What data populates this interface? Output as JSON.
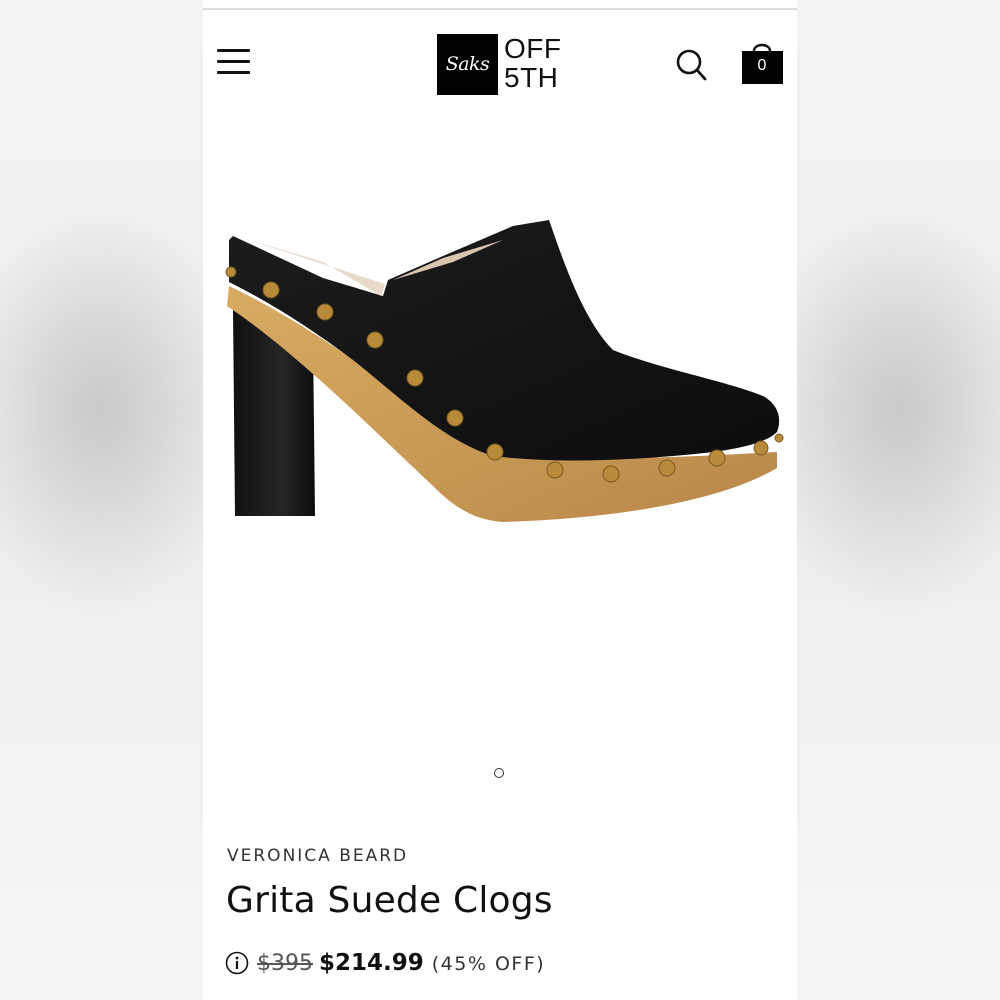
{
  "header": {
    "logo_mark": "Saks",
    "logo_line1": "OFF",
    "logo_line2": "5TH",
    "cart_count": "0",
    "icons": [
      "menu-icon",
      "search-icon",
      "shopping-bag-icon"
    ]
  },
  "gallery": {
    "image_description": "black suede clog with studded wooden platform and block heel",
    "current_image": 1,
    "total_images": 1
  },
  "product": {
    "brand": "VERONICA BEARD",
    "name": "Grita Suede Clogs",
    "original_price": "$395",
    "sale_price": "$214.99",
    "discount": "(45% OFF)"
  },
  "colors": {
    "text": "#111111",
    "logo_bg": "#000000",
    "suede": "#141414",
    "wood": "#c99a55",
    "studs": "#b88a3a"
  }
}
